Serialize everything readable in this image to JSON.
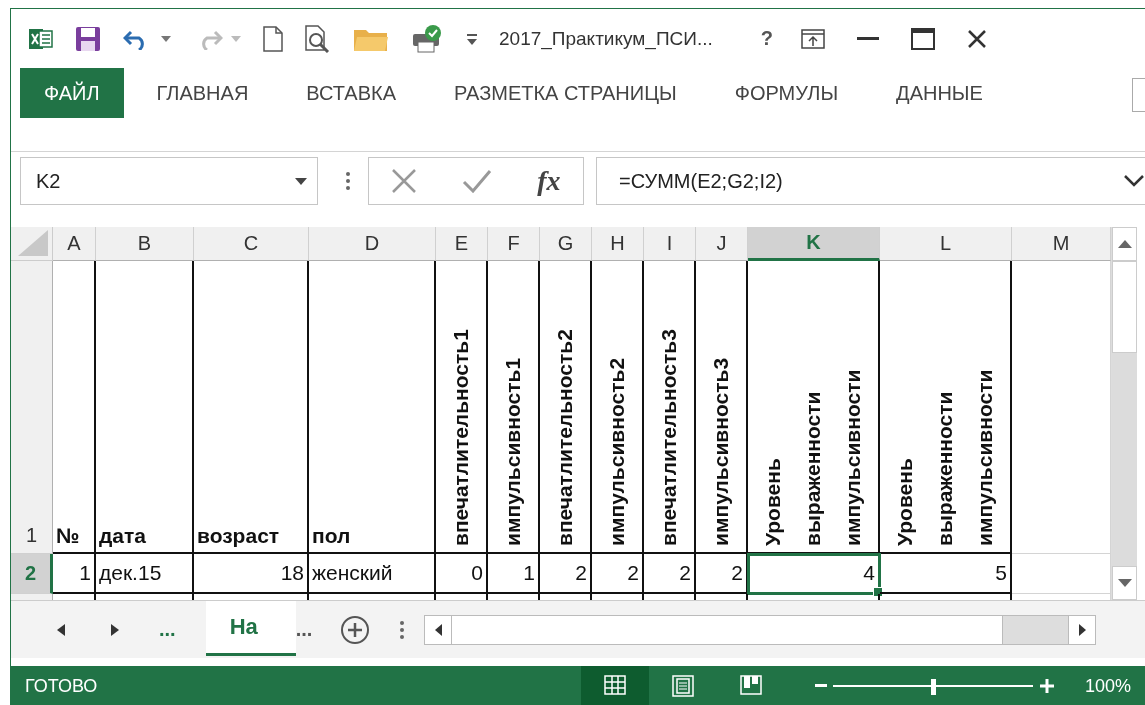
{
  "window": {
    "title": "2017_Практикум_ПСИ...",
    "help": "?"
  },
  "ribbon_tabs": [
    {
      "label": "ФАЙЛ",
      "kind": "file"
    },
    {
      "label": "ГЛАВНАЯ",
      "kind": "tab"
    },
    {
      "label": "ВСТАВКА",
      "kind": "tab"
    },
    {
      "label": "РАЗМЕТКА СТРАНИЦЫ",
      "kind": "tab"
    },
    {
      "label": "ФОРМУЛЫ",
      "kind": "tab"
    },
    {
      "label": "ДАННЫЕ",
      "kind": "tab"
    }
  ],
  "formula_bar": {
    "name_box": "K2",
    "fx": "fx",
    "formula": "=СУММ(E2;G2;I2)"
  },
  "sheet": {
    "columns": [
      {
        "label": "A",
        "selected": false
      },
      {
        "label": "B",
        "selected": false
      },
      {
        "label": "C",
        "selected": false
      },
      {
        "label": "D",
        "selected": false
      },
      {
        "label": "E",
        "selected": false
      },
      {
        "label": "F",
        "selected": false
      },
      {
        "label": "G",
        "selected": false
      },
      {
        "label": "H",
        "selected": false
      },
      {
        "label": "I",
        "selected": false
      },
      {
        "label": "J",
        "selected": false
      },
      {
        "label": "K",
        "selected": true
      },
      {
        "label": "L",
        "selected": false
      },
      {
        "label": "M",
        "selected": false
      }
    ],
    "rows": [
      {
        "label": "1",
        "selected": false,
        "cells": [
          {
            "text": "№",
            "kind": "label",
            "selected": false
          },
          {
            "text": "дата",
            "kind": "label",
            "selected": false
          },
          {
            "text": "возраст",
            "kind": "label",
            "selected": false
          },
          {
            "text": "пол",
            "kind": "label",
            "selected": false
          },
          {
            "text": "впечатлительность1",
            "kind": "vertical",
            "selected": false
          },
          {
            "text": "импульсивность1",
            "kind": "vertical",
            "selected": false
          },
          {
            "text": "впечатлительность2",
            "kind": "vertical",
            "selected": false
          },
          {
            "text": "импульсивность2",
            "kind": "vertical",
            "selected": false
          },
          {
            "text": "впечатлительность3",
            "kind": "vertical",
            "selected": false
          },
          {
            "text": "импульсивность3",
            "kind": "vertical",
            "selected": false
          },
          {
            "text": "Уровень выраженности импульсивности",
            "kind": "vertical",
            "selected": false
          },
          {
            "text": "Уровень выраженности импульсивности",
            "kind": "vertical",
            "selected": false
          }
        ]
      },
      {
        "label": "2",
        "selected": true,
        "cells": [
          {
            "text": "1",
            "kind": "number",
            "selected": false
          },
          {
            "text": "дек.15",
            "kind": "text",
            "selected": false
          },
          {
            "text": "18",
            "kind": "number",
            "selected": false
          },
          {
            "text": "женский",
            "kind": "text",
            "selected": false
          },
          {
            "text": "0",
            "kind": "number",
            "selected": false
          },
          {
            "text": "1",
            "kind": "number",
            "selected": false
          },
          {
            "text": "2",
            "kind": "number",
            "selected": false
          },
          {
            "text": "2",
            "kind": "number",
            "selected": false
          },
          {
            "text": "2",
            "kind": "number",
            "selected": false
          },
          {
            "text": "2",
            "kind": "number",
            "selected": false
          },
          {
            "text": "4",
            "kind": "number",
            "selected": true
          },
          {
            "text": "5",
            "kind": "number",
            "selected": false
          }
        ]
      }
    ]
  },
  "sheet_tabs": {
    "overflow_left": "...",
    "tabs": [
      {
        "label": "На",
        "selected": true
      }
    ],
    "overflow_right": "..."
  },
  "status_bar": {
    "status": "ГОТОВО",
    "views": [
      {
        "kind": "normal",
        "selected": true
      },
      {
        "kind": "page_layout",
        "selected": false
      },
      {
        "kind": "page_break",
        "selected": false
      }
    ],
    "zoom": {
      "level": 0.5,
      "reading": "100%"
    }
  }
}
